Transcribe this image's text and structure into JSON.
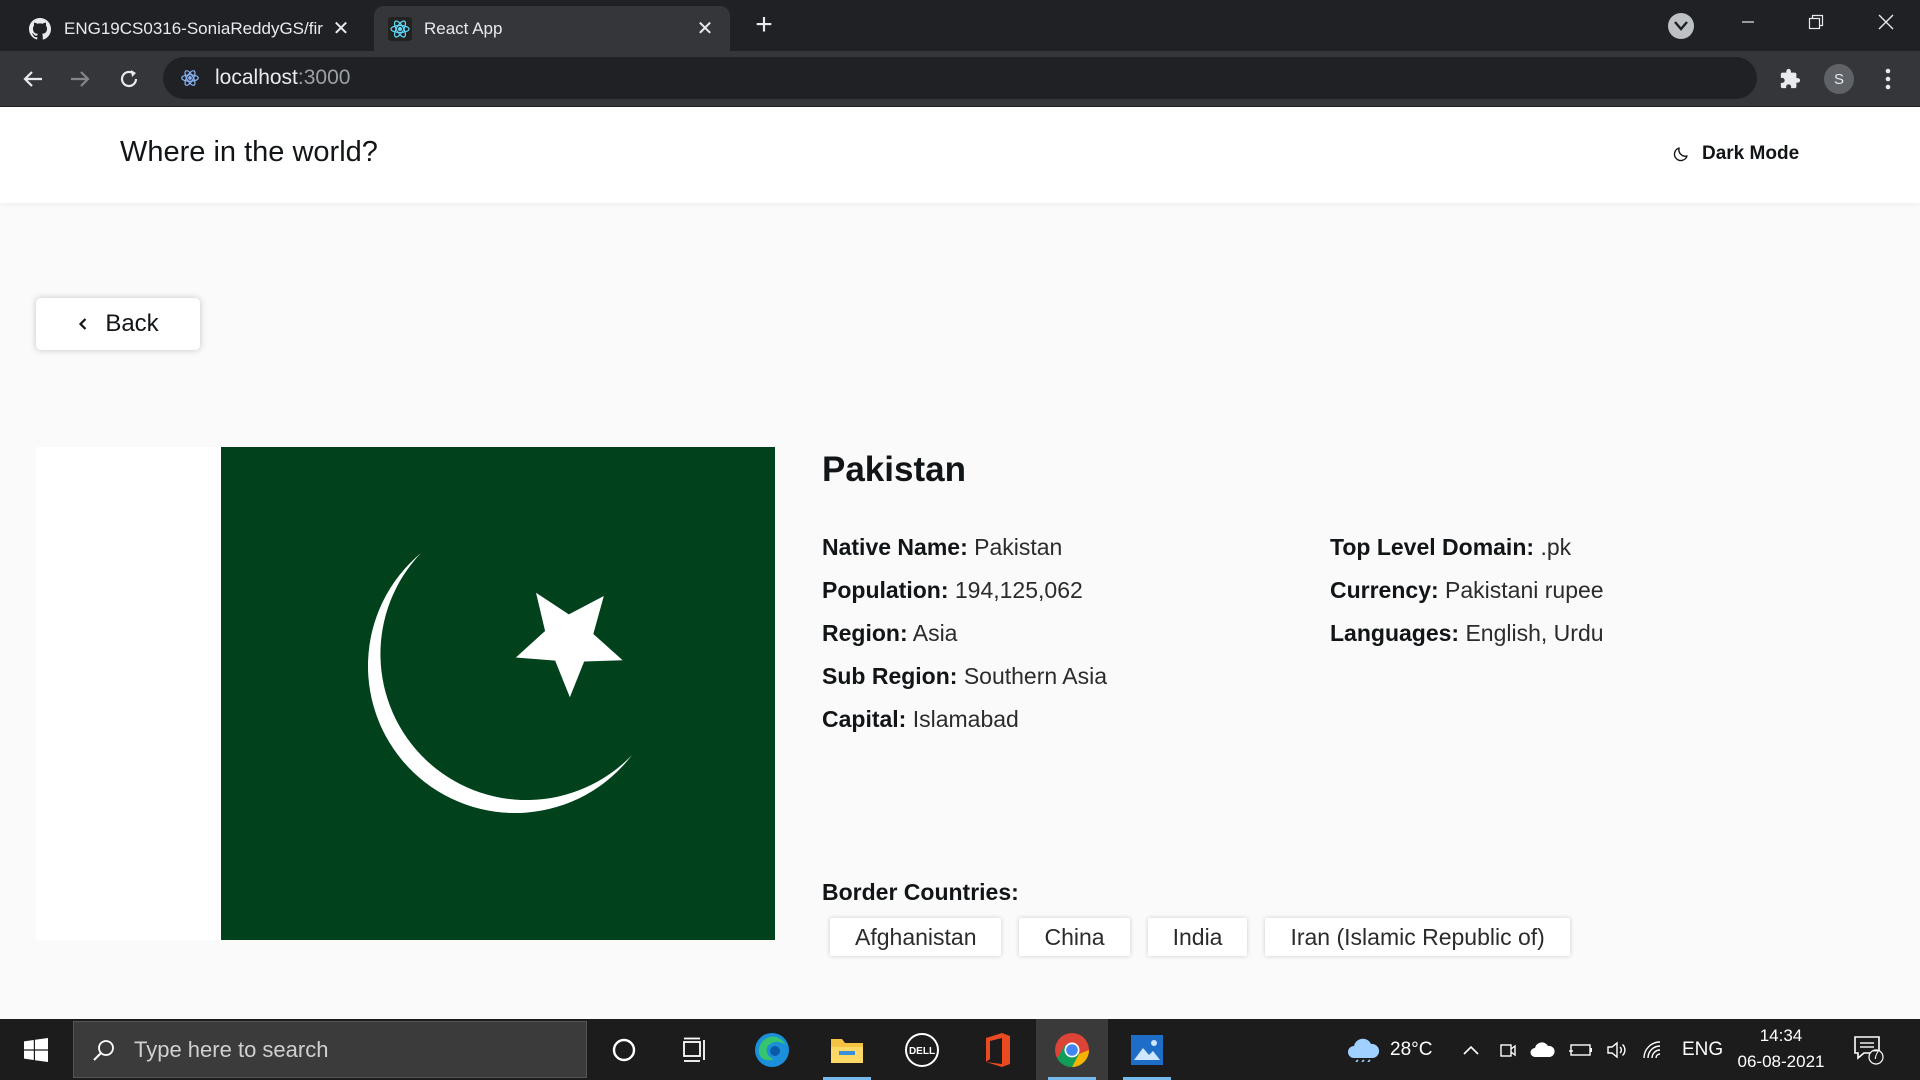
{
  "browser": {
    "tabs": [
      {
        "title": "ENG19CS0316-SoniaReddyGS/fir",
        "icon": "github-icon",
        "active": false
      },
      {
        "title": "React App",
        "icon": "react-icon",
        "active": true
      }
    ],
    "url_host": "localhost",
    "url_port": ":3000",
    "profile_initial": "S"
  },
  "app": {
    "title": "Where in the world?",
    "dark_mode_label": "Dark Mode",
    "back_label": "Back"
  },
  "country": {
    "name": "Pakistan",
    "flag": {
      "green": "#01411c",
      "white": "#ffffff"
    },
    "details_left": [
      {
        "label": "Native Name:",
        "value": "Pakistan"
      },
      {
        "label": "Population:",
        "value": "194,125,062"
      },
      {
        "label": "Region:",
        "value": "Asia"
      },
      {
        "label": "Sub Region:",
        "value": "Southern Asia"
      },
      {
        "label": "Capital:",
        "value": "Islamabad"
      }
    ],
    "details_right": [
      {
        "label": "Top Level Domain:",
        "value": ".pk"
      },
      {
        "label": "Currency:",
        "value": "Pakistani rupee"
      },
      {
        "label": "Languages:",
        "value": "English, Urdu"
      }
    ],
    "border_label": "Border Countries:",
    "borders": [
      "Afghanistan",
      "China",
      "India",
      "Iran (Islamic Republic of)"
    ]
  },
  "taskbar": {
    "search_placeholder": "Type here to search",
    "weather": "28°C",
    "language": "ENG",
    "time": "14:34",
    "date": "06-08-2021",
    "notification_count": "7"
  }
}
